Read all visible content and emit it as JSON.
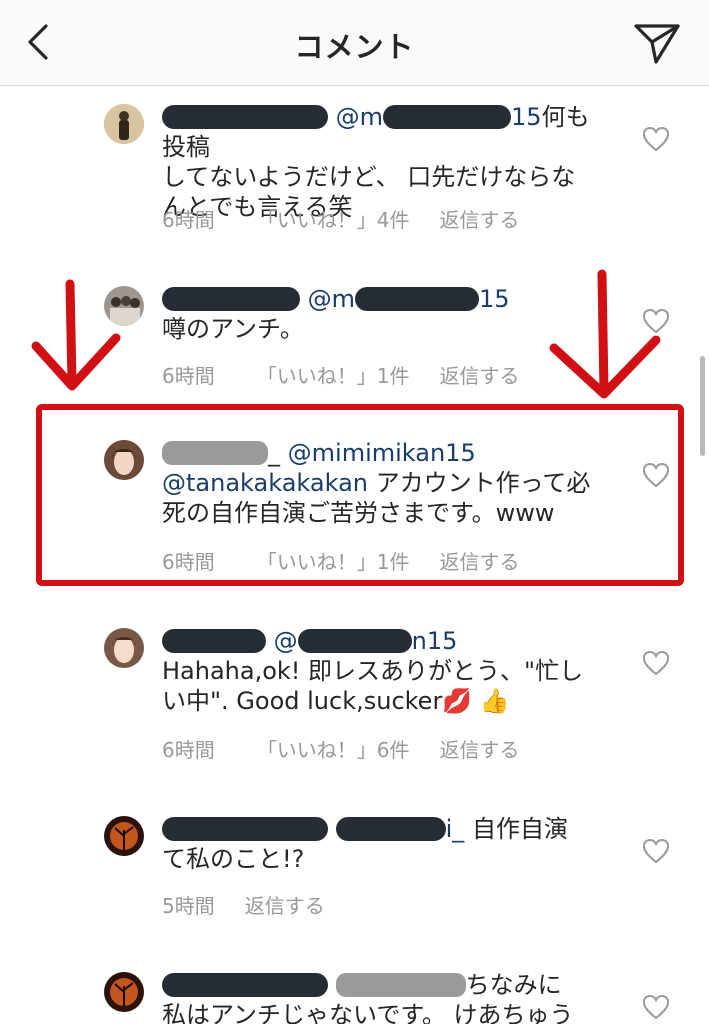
{
  "header": {
    "title": "コメント",
    "back_icon": "chevron-left-icon",
    "share_icon": "paper-plane-icon"
  },
  "comments": [
    {
      "mention": "@m",
      "mention_tail": "15",
      "text_after": "何も投稿",
      "line2": "してないようだけど、 口先だけならな",
      "line3": "んとでも言える笑",
      "time": "6時間",
      "likes": "「いいね！」4件",
      "reply": "返信する"
    },
    {
      "mention": "@m",
      "mention_tail": "15",
      "line2": "噂のアンチ。",
      "time": "6時間",
      "likes": "「いいね！」1件",
      "reply": "返信する"
    },
    {
      "username_tail": "_",
      "mention": "@mimimikan15",
      "line2_mention": "@tanakakakakan",
      "line2_text": " アカウント作って必",
      "line3": "死の自作自演ご苦労さまです。www",
      "time": "6時間",
      "likes": "「いいね！」1件",
      "reply": "返信する"
    },
    {
      "mention": "@",
      "mention_tail": "n15",
      "line2": "Hahaha,ok! 即レスありがとう、\"忙し",
      "line3": "い中\". Good luck,sucker💋 👍",
      "time": "6時間",
      "likes": "「いいね！」6件",
      "reply": "返信する"
    },
    {
      "mention_tail": "i_",
      "text_after": " 自作自演",
      "line2": "て私のこと!?",
      "time": "5時間",
      "reply": "返信する"
    },
    {
      "text_after": "ちなみに",
      "line2": "私はアンチじゃないです。 けあちゅう"
    }
  ],
  "colors": {
    "annotation_red": "#d01014",
    "mention_blue": "#1a3c6c",
    "meta_gray": "#999999"
  }
}
